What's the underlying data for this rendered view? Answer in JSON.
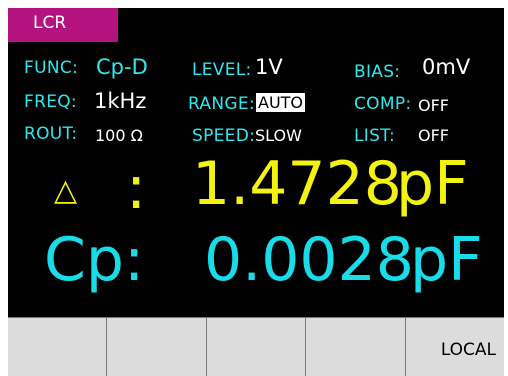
{
  "tab": {
    "label": "LCR"
  },
  "params": {
    "func_label": "FUNC:",
    "func_value": "Cp-D",
    "freq_label": "FREQ:",
    "freq_value": "1kHz",
    "rout_label": "ROUT:",
    "rout_value": "100 Ω",
    "level_label": "LEVEL:",
    "level_value": "1V",
    "range_label": "RANGE:",
    "range_value": "AUTO",
    "speed_label": "SPEED:",
    "speed_value": "SLOW",
    "bias_label": "BIAS:",
    "bias_value": "0mV",
    "comp_label": "COMP:",
    "comp_value": "OFF",
    "list_label": "LIST:",
    "list_value": "OFF"
  },
  "primary": {
    "symbol": "△",
    "colon": ":",
    "value": "1.4728",
    "unit": "pF"
  },
  "secondary": {
    "label": "Cp:",
    "value": "0.0028",
    "unit": "pF"
  },
  "softkeys": [
    "",
    "",
    "",
    "",
    "LOCAL"
  ],
  "colors": {
    "tab": "#b4137f",
    "label": "#2ee8ee",
    "primary": "#f3f30f",
    "secondary": "#18dce8"
  }
}
